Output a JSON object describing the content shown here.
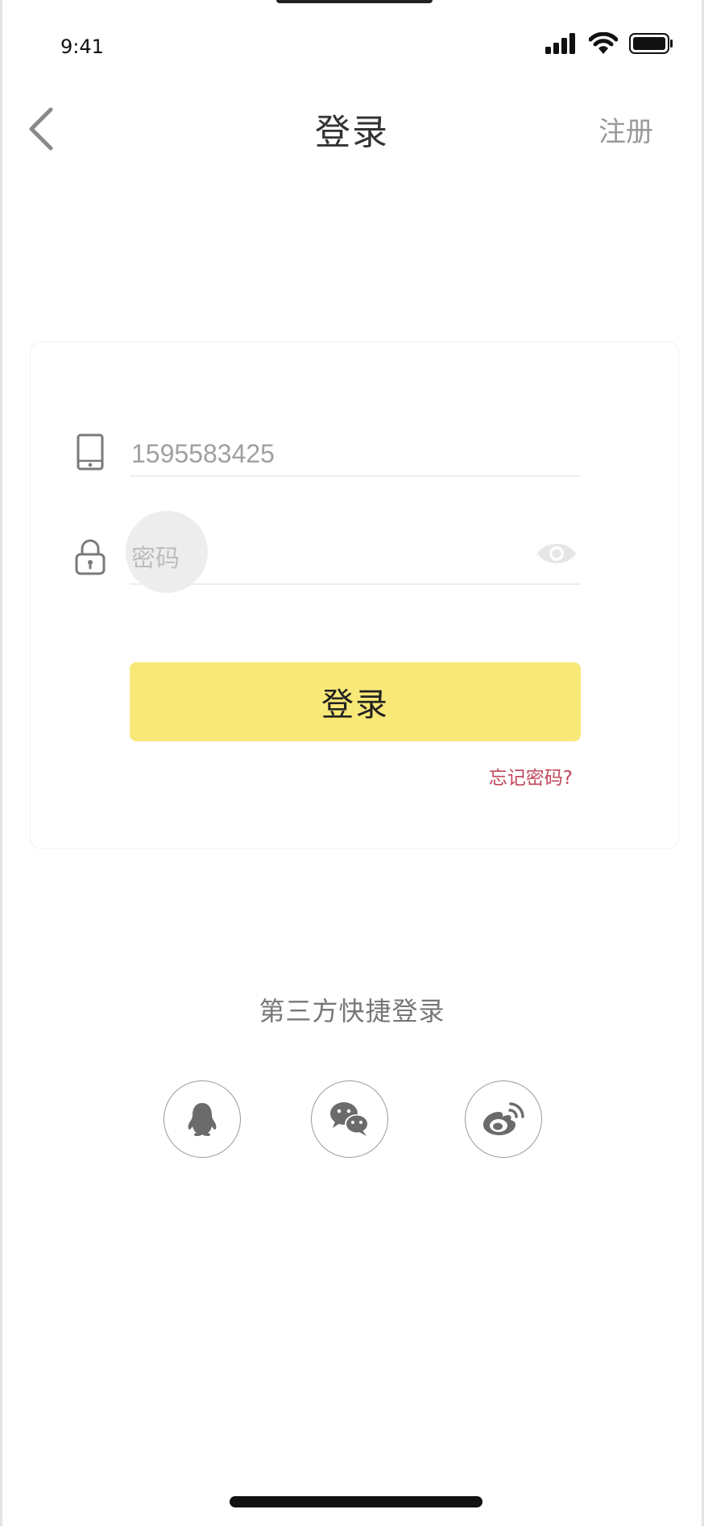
{
  "status_bar": {
    "time": "9:41"
  },
  "nav": {
    "back_icon": "chevron-left-icon",
    "title": "登录",
    "register_label": "注册"
  },
  "form": {
    "phone_value": "1595583425",
    "phone_icon": "mobile-phone-icon",
    "password_placeholder": "密码",
    "password_icon": "lock-icon",
    "visibility_icon": "eye-icon",
    "login_label": "登录",
    "forgot_label": "忘记密码?"
  },
  "third_party": {
    "title": "第三方快捷登录",
    "providers": [
      {
        "icon": "qq-icon"
      },
      {
        "icon": "wechat-icon"
      },
      {
        "icon": "weibo-icon"
      }
    ]
  },
  "colors": {
    "accent": "#f8e878",
    "link": "#c2475a",
    "muted_text": "#9a9a9a",
    "background": "#ffffff"
  }
}
